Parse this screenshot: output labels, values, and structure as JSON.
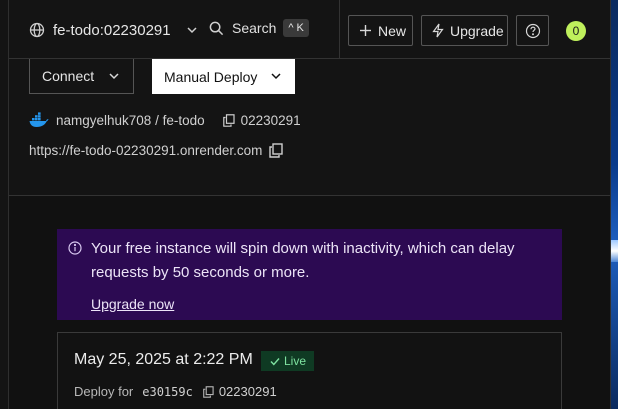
{
  "header": {
    "service_name": "fe-todo:02230291",
    "search_label": "Search",
    "search_shortcut_symbol": "^",
    "search_shortcut_key": "K",
    "new_label": "New",
    "upgrade_label": "Upgrade",
    "notification_count": "0"
  },
  "service": {
    "connect_label": "Connect",
    "deploy_label": "Manual Deploy",
    "repo": "namgyelhuk708 / fe-todo",
    "commit": "02230291",
    "url": "https://fe-todo-02230291.onrender.com"
  },
  "notice": {
    "message": "Your free instance will spin down with inactivity, which can delay requests by 50 seconds or more.",
    "link_label": "Upgrade now"
  },
  "event": {
    "date": "May 25, 2025 at 2:22 PM",
    "status": "Live",
    "deploy_prefix": "Deploy for",
    "commit_hash": "e30159c",
    "commit_id": "02230291"
  },
  "colors": {
    "notice_bg": "#2c0a52",
    "live_badge_bg": "#0f3a23",
    "live_badge_text": "#7ee2a0",
    "notification_badge": "#bff05c"
  }
}
